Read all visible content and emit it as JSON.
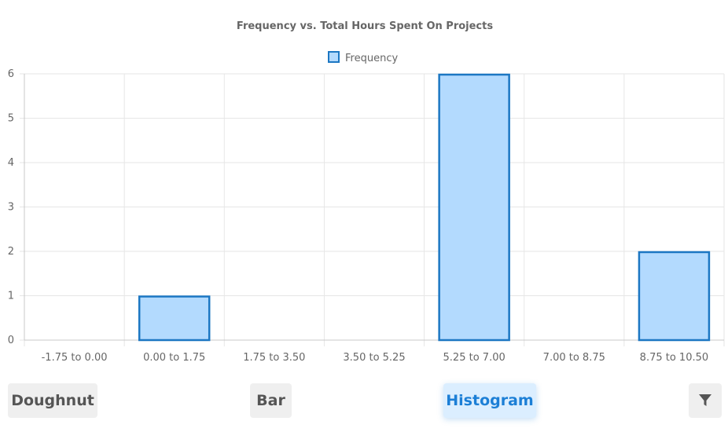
{
  "chart_data": {
    "type": "bar",
    "title": "Frequency vs. Total Hours Spent On Projects",
    "categories": [
      "-1.75 to 0.00",
      "0.00 to 1.75",
      "1.75 to 3.50",
      "3.50 to 5.25",
      "5.25 to 7.00",
      "7.00 to 8.75",
      "8.75 to 10.50"
    ],
    "series": [
      {
        "name": "Frequency",
        "values": [
          0,
          1,
          0,
          0,
          6,
          0,
          2
        ]
      }
    ],
    "ylim": [
      0,
      6
    ],
    "yticks": [
      "0",
      "1",
      "2",
      "3",
      "4",
      "5",
      "6"
    ],
    "grid": true,
    "legend": "top",
    "colors": {
      "fill": "#b3dafe",
      "border": "#1c77c3"
    }
  },
  "buttons": {
    "doughnut": "Doughnut",
    "bar": "Bar",
    "histogram": "Histogram",
    "filter_icon": "filter-icon"
  }
}
